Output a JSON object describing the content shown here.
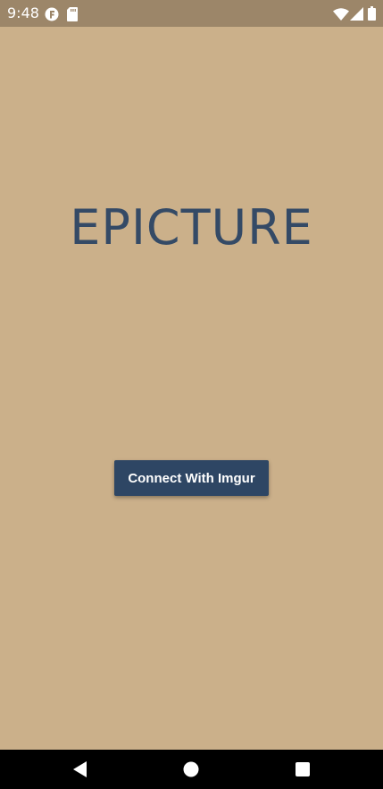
{
  "status_bar": {
    "time": "9:48",
    "icons": [
      "notification-f-icon",
      "sd-card-icon",
      "wifi-icon",
      "signal-icon",
      "battery-icon"
    ]
  },
  "app": {
    "title": "EPICTURE",
    "connect_button_label": "Connect With Imgur"
  },
  "nav_bar": {
    "buttons": [
      "back-icon",
      "home-icon",
      "recents-icon"
    ]
  },
  "colors": {
    "background": "#cbb08a",
    "status_bar": "#9c8669",
    "title": "#344a66",
    "button": "#2e4664",
    "nav_bar": "#000000"
  }
}
